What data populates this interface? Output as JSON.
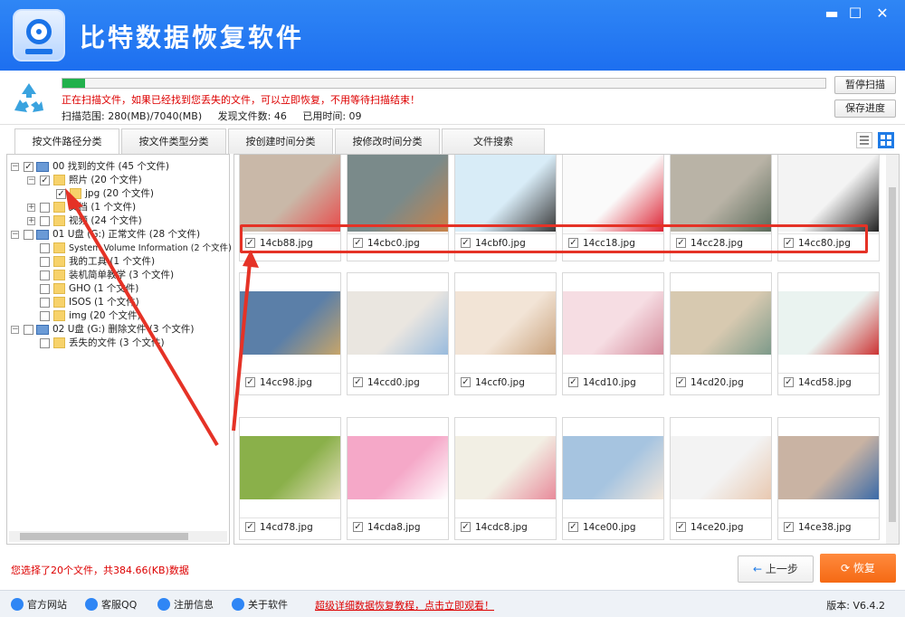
{
  "app": {
    "title": "比特数据恢复软件"
  },
  "window_controls": {
    "minimize": "▬",
    "maximize": "☐",
    "close": "✕"
  },
  "scan": {
    "progress_pct": 3,
    "message": "正在扫描文件，如果已经找到您丢失的文件，可以立即恢复，不用等待扫描结束！",
    "range": "扫描范围: 280(MB)/7040(MB)",
    "found": "发现文件数: 46",
    "elapsed": "已用时间: 09",
    "pause_label": "暂停扫描",
    "save_label": "保存进度"
  },
  "tabs": [
    {
      "label": "按文件路径分类",
      "active": true
    },
    {
      "label": "按文件类型分类",
      "active": false
    },
    {
      "label": "按创建时间分类",
      "active": false
    },
    {
      "label": "按修改时间分类",
      "active": false
    },
    {
      "label": "文件搜索",
      "active": false
    }
  ],
  "tree": [
    {
      "label": "00 找到的文件  (45 个文件)",
      "checked": true
    },
    {
      "label": "照片    (20 个文件)",
      "checked": true
    },
    {
      "label": "jpg   (20 个文件)",
      "checked": true
    },
    {
      "label": "文档    (1 个文件)",
      "checked": false
    },
    {
      "label": "视频    (24 个文件)",
      "checked": false
    },
    {
      "label": "01 U盘 (G:) 正常文件 (28 个文件)",
      "checked": false
    },
    {
      "label": "System Volume Information    (2 个文件)",
      "checked": false
    },
    {
      "label": "我的工具    (1 个文件)",
      "checked": false
    },
    {
      "label": "装机简单教学    (3 个文件)",
      "checked": false
    },
    {
      "label": "GHO    (1 个文件)",
      "checked": false
    },
    {
      "label": "ISOS    (1 个文件)",
      "checked": false
    },
    {
      "label": "img    (20 个文件)",
      "checked": false
    },
    {
      "label": "02 U盘 (G:) 删除文件 (3 个文件)",
      "checked": false
    },
    {
      "label": "丢失的文件    (3 个文件)",
      "checked": false
    }
  ],
  "files": [
    {
      "name": "14cb88.jpg",
      "checked": true
    },
    {
      "name": "14cbc0.jpg",
      "checked": true
    },
    {
      "name": "14cbf0.jpg",
      "checked": true
    },
    {
      "name": "14cc18.jpg",
      "checked": true
    },
    {
      "name": "14cc28.jpg",
      "checked": true
    },
    {
      "name": "14cc80.jpg",
      "checked": true
    },
    {
      "name": "14cc98.jpg",
      "checked": true
    },
    {
      "name": "14ccd0.jpg",
      "checked": true
    },
    {
      "name": "14ccf0.jpg",
      "checked": true
    },
    {
      "name": "14cd10.jpg",
      "checked": true
    },
    {
      "name": "14cd20.jpg",
      "checked": true
    },
    {
      "name": "14cd58.jpg",
      "checked": true
    },
    {
      "name": "14cd78.jpg",
      "checked": true
    },
    {
      "name": "14cda8.jpg",
      "checked": true
    },
    {
      "name": "14cdc8.jpg",
      "checked": true
    },
    {
      "name": "14ce00.jpg",
      "checked": true
    },
    {
      "name": "14ce20.jpg",
      "checked": true
    },
    {
      "name": "14ce38.jpg",
      "checked": true
    }
  ],
  "status": {
    "selection": "您选择了20个文件，共384.66(KB)数据"
  },
  "buttons": {
    "prev": "上一步",
    "recover": "恢复"
  },
  "footer": {
    "website": "官方网站",
    "qq": "客服QQ",
    "register": "注册信息",
    "about": "关于软件",
    "tutorial": "超级详细数据恢复教程，点击立即观看！",
    "version": "版本: V6.4.2"
  },
  "colors": {
    "titlebar": "#1d6ff0",
    "highlight": "#e53226",
    "recover_button": "#f56a14",
    "progress": "#22b14c"
  }
}
